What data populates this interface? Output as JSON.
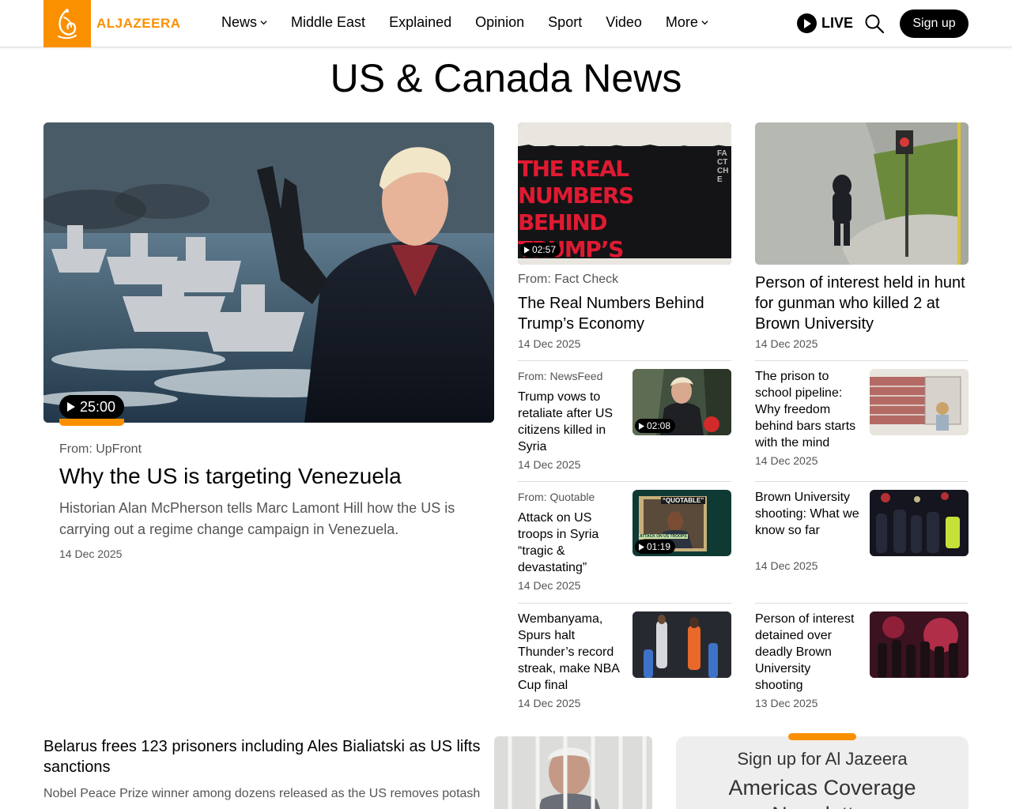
{
  "header": {
    "logo_text": "ALJAZEERA",
    "nav": [
      {
        "label": "News",
        "dropdown": true
      },
      {
        "label": "Middle East",
        "dropdown": false
      },
      {
        "label": "Explained",
        "dropdown": false
      },
      {
        "label": "Opinion",
        "dropdown": false
      },
      {
        "label": "Sport",
        "dropdown": false
      },
      {
        "label": "Video",
        "dropdown": false
      },
      {
        "label": "More",
        "dropdown": true
      }
    ],
    "live_label": "LIVE",
    "signup_label": "Sign up",
    "brand_color": "#fa9000"
  },
  "page_title": "US & Canada News",
  "featured": {
    "duration": "25:00",
    "from": "From: UpFront",
    "title": "Why the US is targeting Venezuela",
    "description": "Historian Alan McPherson tells Marc Lamont Hill how the US is carrying out a regime change campaign in Venezuela.",
    "date": "14 Dec 2025"
  },
  "col2_top": {
    "duration": "02:57",
    "image_text": "THE REAL NUMBERS BEHIND TRUMP’S ECONOMY",
    "image_tag": "FACT CHE",
    "from": "From: Fact Check",
    "title": "The Real Numbers Behind Trump’s Economy",
    "date": "14 Dec 2025"
  },
  "col3_top": {
    "title": "Person of interest held in hunt for gunman who killed 2 at Brown University",
    "date": "14 Dec 2025"
  },
  "col2_list": [
    {
      "from": "From: NewsFeed",
      "title": "Trump vows to retaliate after US citizens killed in Syria",
      "date": "14 Dec 2025",
      "duration": "02:08"
    },
    {
      "from": "From: Quotable",
      "title": "Attack on US troops in Syria “tragic & devastating”",
      "date": "14 Dec 2025",
      "duration": "01:19",
      "image_text": "“QUOTABLE”",
      "image_caption": "ATTACK ON US TROOPS"
    },
    {
      "from": "",
      "title": "Wembanyama, Spurs halt Thunder’s record streak, make NBA Cup final",
      "date": "14 Dec 2025",
      "duration": ""
    }
  ],
  "col3_list": [
    {
      "title": "The prison to school pipeline: Why freedom behind bars starts with the mind",
      "date": "14 Dec 2025"
    },
    {
      "title": "Brown University shooting: What we know so far",
      "date": "14 Dec 2025"
    },
    {
      "title": "Person of interest detained over deadly Brown University shooting",
      "date": "13 Dec 2025"
    }
  ],
  "bottom_story": {
    "title": "Belarus frees 123 prisoners including Ales Bialiatski as US lifts sanctions",
    "description": "Nobel Peace Prize winner among dozens released as the US removes potash"
  },
  "newsletter": {
    "subtitle": "Sign up for Al Jazeera",
    "title": "Americas Coverage Newsletter"
  }
}
